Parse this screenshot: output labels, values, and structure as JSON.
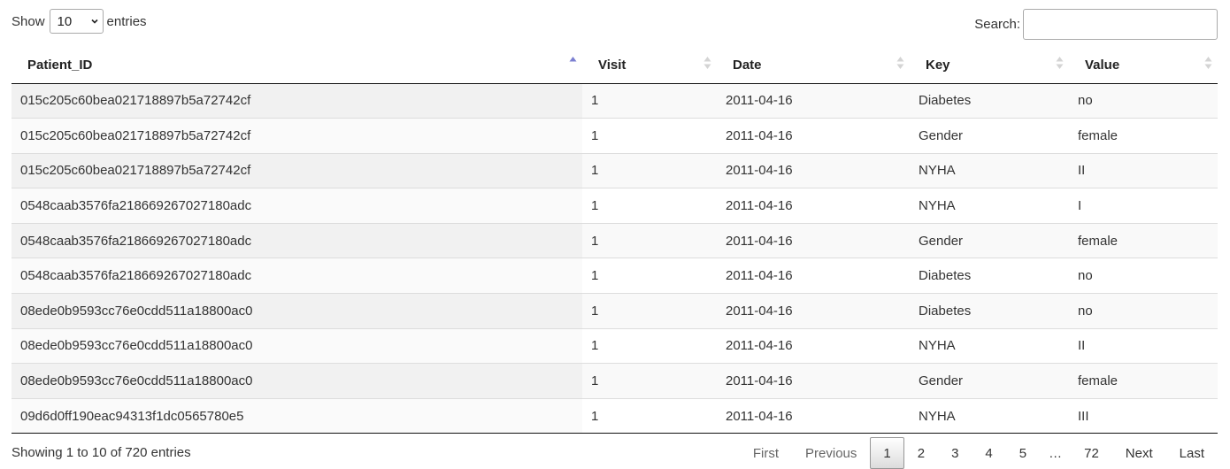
{
  "length_control": {
    "show_label": "Show",
    "selected": "10",
    "entries_label": "entries"
  },
  "search": {
    "label": "Search:",
    "value": "",
    "placeholder": ""
  },
  "table": {
    "columns": [
      {
        "label": "Patient_ID",
        "sort": "asc"
      },
      {
        "label": "Visit",
        "sort": "none"
      },
      {
        "label": "Date",
        "sort": "none"
      },
      {
        "label": "Key",
        "sort": "none"
      },
      {
        "label": "Value",
        "sort": "none"
      }
    ],
    "rows": [
      [
        "015c205c60bea021718897b5a72742cf",
        "1",
        "2011-04-16",
        "Diabetes",
        "no"
      ],
      [
        "015c205c60bea021718897b5a72742cf",
        "1",
        "2011-04-16",
        "Gender",
        "female"
      ],
      [
        "015c205c60bea021718897b5a72742cf",
        "1",
        "2011-04-16",
        "NYHA",
        "II"
      ],
      [
        "0548caab3576fa218669267027180adc",
        "1",
        "2011-04-16",
        "NYHA",
        "I"
      ],
      [
        "0548caab3576fa218669267027180adc",
        "1",
        "2011-04-16",
        "Gender",
        "female"
      ],
      [
        "0548caab3576fa218669267027180adc",
        "1",
        "2011-04-16",
        "Diabetes",
        "no"
      ],
      [
        "08ede0b9593cc76e0cdd511a18800ac0",
        "1",
        "2011-04-16",
        "Diabetes",
        "no"
      ],
      [
        "08ede0b9593cc76e0cdd511a18800ac0",
        "1",
        "2011-04-16",
        "NYHA",
        "II"
      ],
      [
        "08ede0b9593cc76e0cdd511a18800ac0",
        "1",
        "2011-04-16",
        "Gender",
        "female"
      ],
      [
        "09d6d0ff190eac94313f1dc0565780e5",
        "1",
        "2011-04-16",
        "NYHA",
        "III"
      ]
    ]
  },
  "info": "Showing 1 to 10 of 720 entries",
  "pagination": {
    "first": "First",
    "previous": "Previous",
    "pages": [
      "1",
      "2",
      "3",
      "4",
      "5"
    ],
    "current": "1",
    "ellipsis": "…",
    "last_page": "72",
    "next": "Next",
    "last": "Last"
  },
  "colors": {
    "sort_active": "#7b7fd1",
    "sort_inactive": "#d4d4d4",
    "header_border": "#111111"
  }
}
